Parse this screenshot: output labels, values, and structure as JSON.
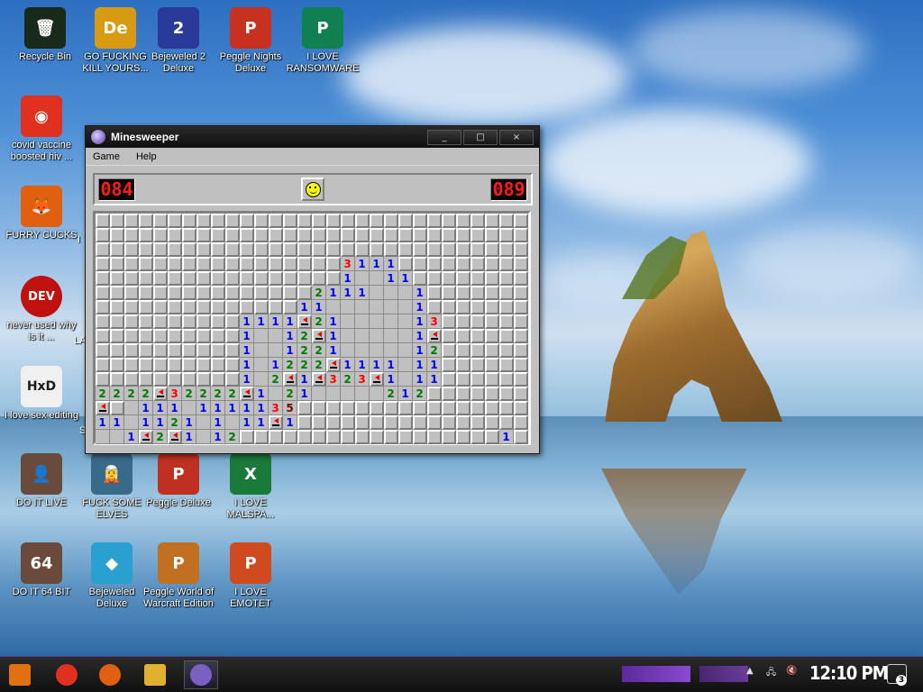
{
  "desktop": {
    "icons": [
      {
        "label": "Recycle Bin",
        "icon": "recycle-bin-icon",
        "color": "#1a2a1a",
        "glyph": "🗑"
      },
      {
        "label": "GO FUCKING KILL YOURS...",
        "icon": "de-app-icon",
        "color": "#d89a10",
        "glyph": "De"
      },
      {
        "label": "Bejeweled 2 Deluxe",
        "icon": "bejeweled2-icon",
        "color": "#2a3a9a",
        "glyph": "2"
      },
      {
        "label": "Peggle Nights Deluxe",
        "icon": "peggle-nights-icon",
        "color": "#c83020",
        "glyph": "P"
      },
      {
        "label": "I LOVE RANSOMWARE",
        "icon": "publisher-icon",
        "color": "#108050",
        "glyph": "P"
      },
      {
        "label": "covid vaccine boosted hiv ...",
        "icon": "chrome-icon",
        "color": "#e03020",
        "glyph": "◉"
      },
      {
        "label": "FURRY CUCKS",
        "icon": "firefox-icon",
        "color": "#e06010",
        "glyph": "🦊"
      },
      {
        "label": "never used why is it ...",
        "icon": "devcpp-icon",
        "color": "#c01010",
        "glyph": "DEV"
      },
      {
        "label": "I love sex editing",
        "icon": "hxd-icon",
        "color": "#f0f0f0",
        "glyph": "HxD"
      },
      {
        "label": "DO IT LIVE",
        "icon": "portrait-icon",
        "color": "#6a4a3a",
        "glyph": "👤"
      },
      {
        "label": "FUCK SOME ELVES",
        "icon": "elf-icon",
        "color": "#3a6a8a",
        "glyph": "🧝"
      },
      {
        "label": "Peggle Deluxe",
        "icon": "peggle-icon",
        "color": "#c03020",
        "glyph": "P"
      },
      {
        "label": "I LOVE MALSPA...",
        "icon": "excel-icon",
        "color": "#1a7a3a",
        "glyph": "X"
      },
      {
        "label": "DO IT 64 BIT",
        "icon": "portrait64-icon",
        "color": "#6a4a3a",
        "glyph": "64"
      },
      {
        "label": "Bejeweled Deluxe",
        "icon": "diamond-icon",
        "color": "#2aa0d0",
        "glyph": "◆"
      },
      {
        "label": "Peggle World of Warcraft Edition",
        "icon": "peggle-wow-icon",
        "color": "#c07020",
        "glyph": "P"
      },
      {
        "label": "I LOVE EMOTET",
        "icon": "powerpoint-icon",
        "color": "#d04a20",
        "glyph": "P"
      }
    ],
    "partial_labels": [
      "I",
      "LA",
      "S"
    ]
  },
  "window": {
    "title": "Minesweeper",
    "minimize": "_",
    "maximize": "□",
    "close": "×",
    "menu": [
      "Game",
      "Help"
    ],
    "mines_left": "084",
    "timer": "089"
  },
  "board": {
    "cols": 30,
    "rows": 16,
    "legend": {
      "#": "unopened",
      ".": "opened",
      "F": "flag",
      "1-8": "number"
    },
    "cells": [
      "##############################",
      "##############################",
      "##############################",
      "#################3111#########",
      "#################1..11########",
      "###############2111...1#######",
      "##############11......1#######",
      "##########1111F21.....13######",
      "##########1..12F1.....1F######",
      "##########1..1221.....12######",
      "##########1.1222F1111.11######",
      "##########1.2F1F323F1.11######",
      "2222F32222F1.21.....212#######",
      "F#.111.1111135################",
      "11.1121.1.11F1################",
      "..1F2F1.12##################1#"
    ],
    "number_colors": {
      "1": "#0000ff",
      "2": "#007b00",
      "3": "#ff0000",
      "4": "#00007b",
      "5": "#7b0000"
    }
  },
  "taskbar": {
    "items": [
      {
        "icon": "start-icon",
        "color": "#e07010"
      },
      {
        "icon": "chrome-icon",
        "color": "#e03020"
      },
      {
        "icon": "firefox-icon",
        "color": "#e06010"
      },
      {
        "icon": "explorer-folder-icon",
        "color": "#e0b030"
      },
      {
        "icon": "minesweeper-icon",
        "color": "#7a60c0"
      }
    ],
    "clock": "12:10 PM",
    "notification_count": "3"
  }
}
